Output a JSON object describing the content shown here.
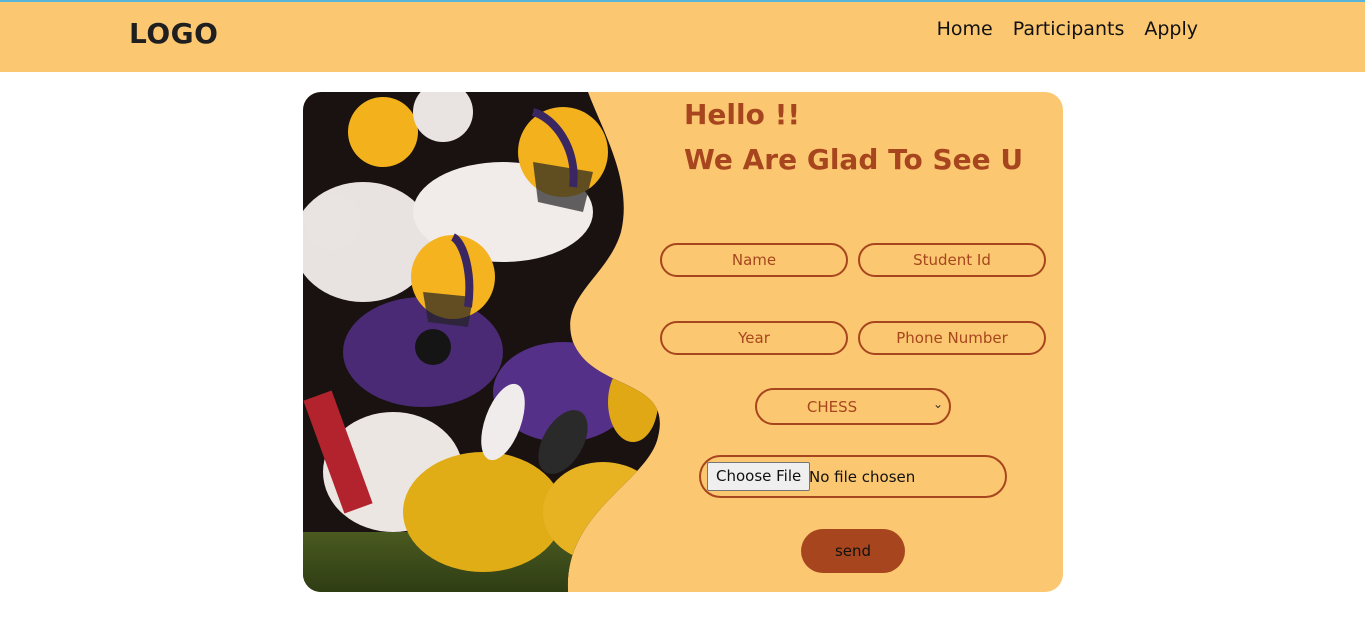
{
  "header": {
    "logo": "LOGO",
    "nav": [
      "Home",
      "Participants",
      "Apply"
    ]
  },
  "card": {
    "greeting": "Hello !!",
    "subtitle": "We Are Glad To See U",
    "fields": {
      "name_placeholder": "Name",
      "student_id_placeholder": "Student Id",
      "year_placeholder": "Year",
      "phone_placeholder": "Phone Number"
    },
    "select": {
      "selected": "CHESS"
    },
    "file": {
      "button_label": "Choose File",
      "status": "No file chosen"
    },
    "submit_label": "send"
  },
  "colors": {
    "header_bg": "#fcc771",
    "card_bg": "#fcc771",
    "accent": "#a7461e"
  }
}
